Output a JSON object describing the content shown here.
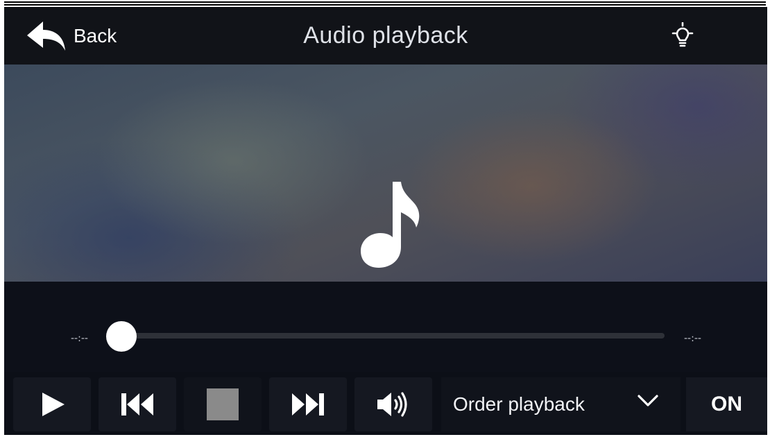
{
  "header": {
    "back_label": "Back",
    "title": "Audio playback",
    "back_icon": "back-arrow-icon",
    "bulb_icon": "lightbulb-icon"
  },
  "artwork": {
    "icon": "music-note-icon"
  },
  "progress": {
    "elapsed": "--:--",
    "total": "--:--",
    "position_fraction": 0.0
  },
  "controls": {
    "play_icon": "play-icon",
    "previous_icon": "previous-track-icon",
    "stop_icon": "stop-icon",
    "next_icon": "next-track-icon",
    "volume_icon": "volume-icon",
    "mode_label": "Order playback",
    "mode_icon": "chevron-down-icon",
    "toggle_label": "ON"
  },
  "colors": {
    "background": "#0c0f17",
    "button": "#151821",
    "stop_disabled": "#8a8a8a",
    "text": "#ffffff"
  }
}
